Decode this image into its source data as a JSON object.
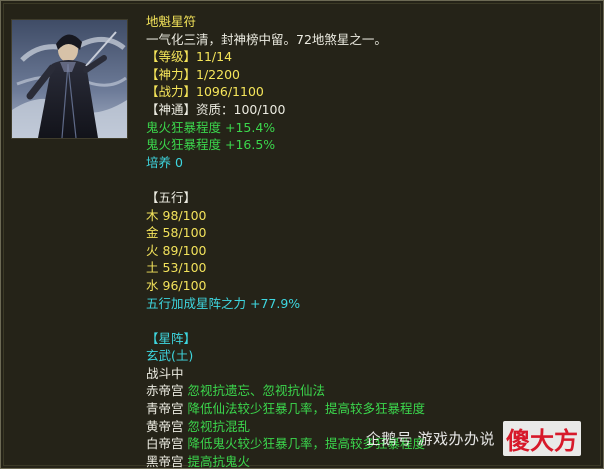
{
  "card": {
    "name": "地魁星符",
    "description": "一气化三清，封神榜中留。72地煞星之一。",
    "level_label": "【等级】",
    "level_value": "11/14",
    "power_label": "【神力】",
    "power_value": "1/2200",
    "combat_label": "【战力】",
    "combat_value": "1096/1100",
    "divine_label": "【神通】",
    "divine_value": "资质：100/100",
    "stat1": "鬼火狂暴程度 +15.4%",
    "stat2": "鬼火狂暴程度 +16.5%",
    "cultivate": "培养 0"
  },
  "wuxing": {
    "header": "【五行】",
    "items": [
      {
        "element": "木",
        "value": "98/100"
      },
      {
        "element": "金",
        "value": "58/100"
      },
      {
        "element": "火",
        "value": "89/100"
      },
      {
        "element": "土",
        "value": "53/100"
      },
      {
        "element": "水",
        "value": "96/100"
      }
    ],
    "bonus": "五行加成星阵之力 +77.9%"
  },
  "xingzhen": {
    "header": "【星阵】",
    "name": "玄武(土)",
    "status": "战斗中",
    "palaces": [
      {
        "name": "赤帝宫",
        "effect": "忽视抗遗忘、忽视抗仙法"
      },
      {
        "name": "青帝宫",
        "effect": "降低仙法较少狂暴几率，提高较多狂暴程度"
      },
      {
        "name": "黄帝宫",
        "effect": "忽视抗混乱"
      },
      {
        "name": "白帝宫",
        "effect": "降低鬼火较少狂暴几率，提高较多狂暴程度"
      },
      {
        "name": "黑帝宫",
        "effect": "提高抗鬼火"
      }
    ]
  },
  "watermark": {
    "label": "企鹅号 游戏办办说",
    "brand": "傻大方"
  },
  "colors": {
    "title": "#f5e55a",
    "normal": "#ecebe1",
    "green": "#3bd64c",
    "cyan": "#3ed7e0"
  }
}
